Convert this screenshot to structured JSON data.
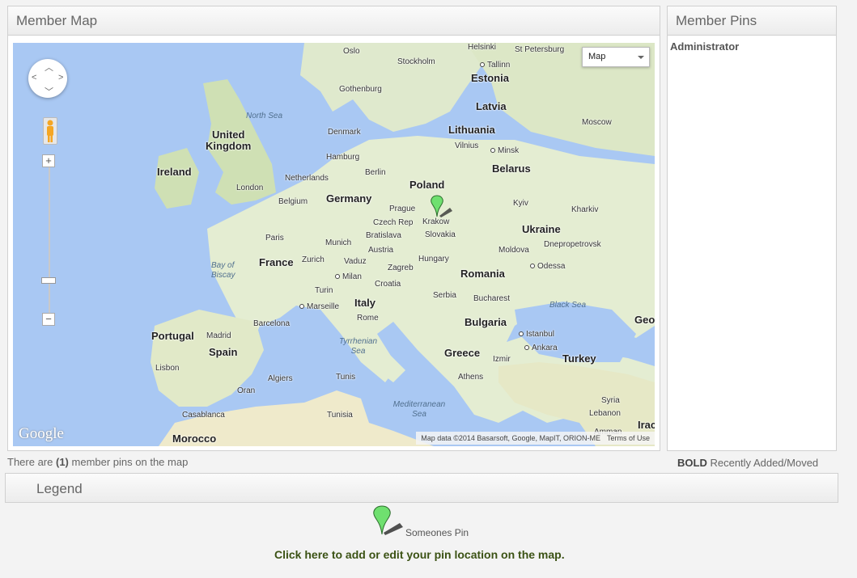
{
  "map_panel": {
    "title": "Member Map"
  },
  "pins_panel": {
    "title": "Member Pins",
    "pins": [
      "Administrator"
    ]
  },
  "map": {
    "map_type": "Map",
    "google": "Google",
    "map_data": "Map data ©2014 Basarsoft, Google, MapIT, ORION-ME",
    "terms": "Terms of Use",
    "labels": {
      "oslo": "Oslo",
      "stockholm": "Stockholm",
      "helsinki": "Helsinki",
      "st_petersburg": "St Petersburg",
      "tallinn": "Tallinn",
      "estonia": "Estonia",
      "gothenburg": "Gothenburg",
      "latvia": "Latvia",
      "north_sea": "North Sea",
      "denmark": "Denmark",
      "lithuania": "Lithuania",
      "moscow": "Moscow",
      "vilnius": "Vilnius",
      "united_kingdom": "United Kingdom",
      "hamburg": "Hamburg",
      "minsk": "Minsk",
      "ireland": "Ireland",
      "netherlands": "Netherlands",
      "berlin": "Berlin",
      "belarus": "Belarus",
      "london": "London",
      "poland": "Poland",
      "belgium": "Belgium",
      "germany": "Germany",
      "prague": "Prague",
      "kyiv": "Kyiv",
      "kharkiv": "Kharkiv",
      "czech_rep": "Czech Rep",
      "krakow": "Krakow",
      "ukraine": "Ukraine",
      "paris": "Paris",
      "bratislava": "Bratislava",
      "slovakia": "Slovakia",
      "munich": "Munich",
      "austria": "Austria",
      "dnepropetrovsk": "Dnepropetrovsk",
      "bay_of_biscay": "Bay of Biscay",
      "france": "France",
      "zurich": "Zurich",
      "vaduz": "Vaduz",
      "hungary": "Hungary",
      "moldova": "Moldova",
      "zagreb": "Zagreb",
      "odessa": "Odessa",
      "milan": "Milan",
      "croatia": "Croatia",
      "romania": "Romania",
      "turin": "Turin",
      "serbia": "Serbia",
      "bucharest": "Bucharest",
      "black_sea": "Black Sea",
      "marseille": "Marseille",
      "italy": "Italy",
      "portugal": "Portugal",
      "madrid": "Madrid",
      "barcelona": "Barcelona",
      "rome": "Rome",
      "bulgaria": "Bulgaria",
      "istanbul": "Istanbul",
      "geo": "Geo",
      "spain": "Spain",
      "tyrrhenian_sea": "Tyrrhenian Sea",
      "ankara": "Ankara",
      "lisbon": "Lisbon",
      "greece": "Greece",
      "izmir": "Izmir",
      "turkey": "Turkey",
      "algiers": "Algiers",
      "tunis": "Tunis",
      "athens": "Athens",
      "oran": "Oran",
      "mediterranean_sea": "Mediterranean Sea",
      "syria": "Syria",
      "casablanca": "Casablanca",
      "tunisia": "Tunisia",
      "lebanon": "Lebanon",
      "amman": "Amman",
      "iraq": "Irac",
      "morocco": "Morocco"
    }
  },
  "footer": {
    "count_prefix": "There are",
    "count": "(1)",
    "count_suffix": "member pins on the map",
    "bold_word": "BOLD",
    "bold_desc": "Recently Added/Moved"
  },
  "legend": {
    "title": "Legend",
    "pin_label": "Someones Pin",
    "edit_link": "Click here to add or edit your pin location on the map."
  },
  "colors": {
    "pin": "#6fe06f",
    "link": "#3b5214",
    "water": "#a9c8f3",
    "land": "#e9efd6"
  }
}
